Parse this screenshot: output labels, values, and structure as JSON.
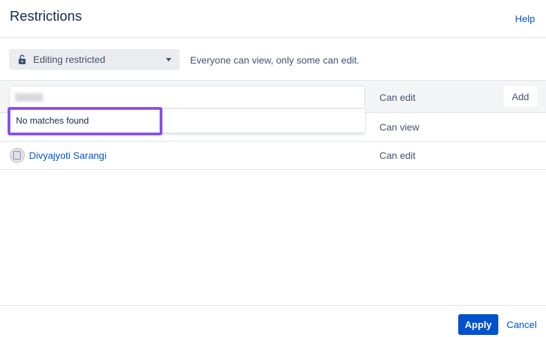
{
  "header": {
    "title": "Restrictions",
    "help_label": "Help"
  },
  "mode": {
    "selected": "Editing restricted",
    "description": "Everyone can view, only some can edit.",
    "icon": "unlocked-padlock-icon"
  },
  "table": {
    "input_row": {
      "permission": "Can edit",
      "add_label": "Add",
      "search_value": ""
    },
    "dropdown": {
      "message": "No matches found"
    },
    "rows": [
      {
        "user": "",
        "permission": "Can view"
      },
      {
        "user": "Divyajyoti Sarangi",
        "permission": "Can edit"
      }
    ]
  },
  "footer": {
    "apply_label": "Apply",
    "cancel_label": "Cancel"
  },
  "colors": {
    "accent": "#0052cc",
    "highlight": "#8a4fe8",
    "neutral_bg": "#ebecf0"
  }
}
